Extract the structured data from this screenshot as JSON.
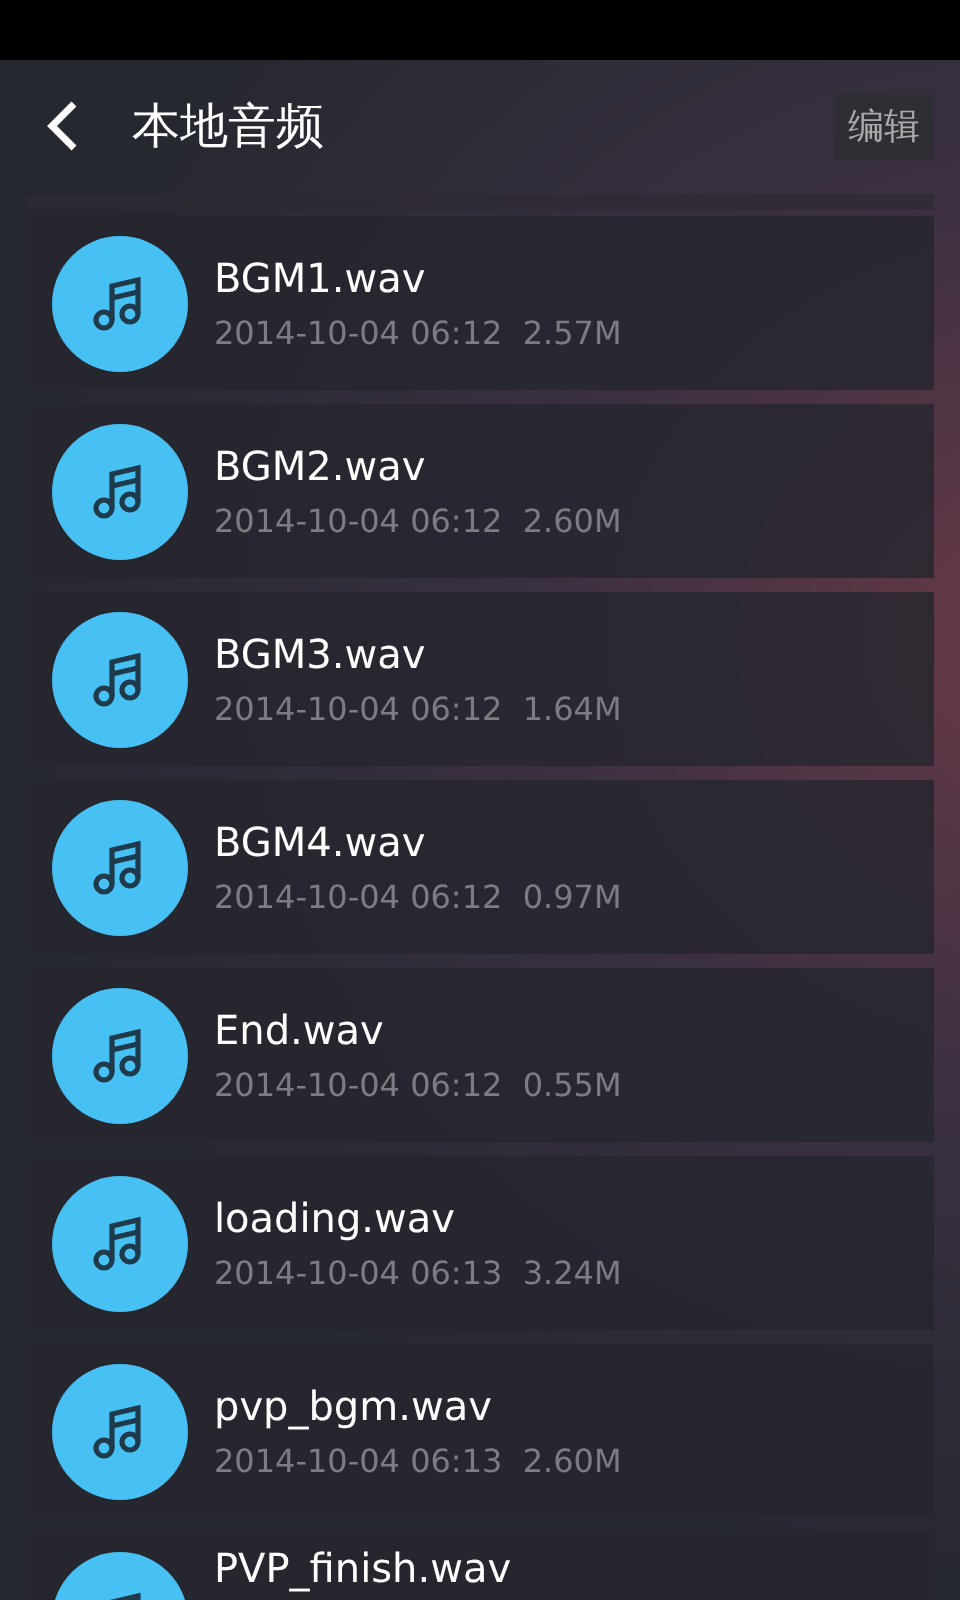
{
  "header": {
    "title": "本地音频",
    "action": "编辑"
  },
  "files": [
    {
      "name": "BGM1.wav",
      "date": "2014-10-04 06:12",
      "size": "2.57M"
    },
    {
      "name": "BGM2.wav",
      "date": "2014-10-04 06:12",
      "size": "2.60M"
    },
    {
      "name": "BGM3.wav",
      "date": "2014-10-04 06:12",
      "size": "1.64M"
    },
    {
      "name": "BGM4.wav",
      "date": "2014-10-04 06:12",
      "size": "0.97M"
    },
    {
      "name": "End.wav",
      "date": "2014-10-04 06:12",
      "size": "0.55M"
    },
    {
      "name": "loading.wav",
      "date": "2014-10-04 06:13",
      "size": "3.24M"
    },
    {
      "name": "pvp_bgm.wav",
      "date": "2014-10-04 06:13",
      "size": "2.60M"
    },
    {
      "name": "PVP_finish.wav"
    }
  ]
}
